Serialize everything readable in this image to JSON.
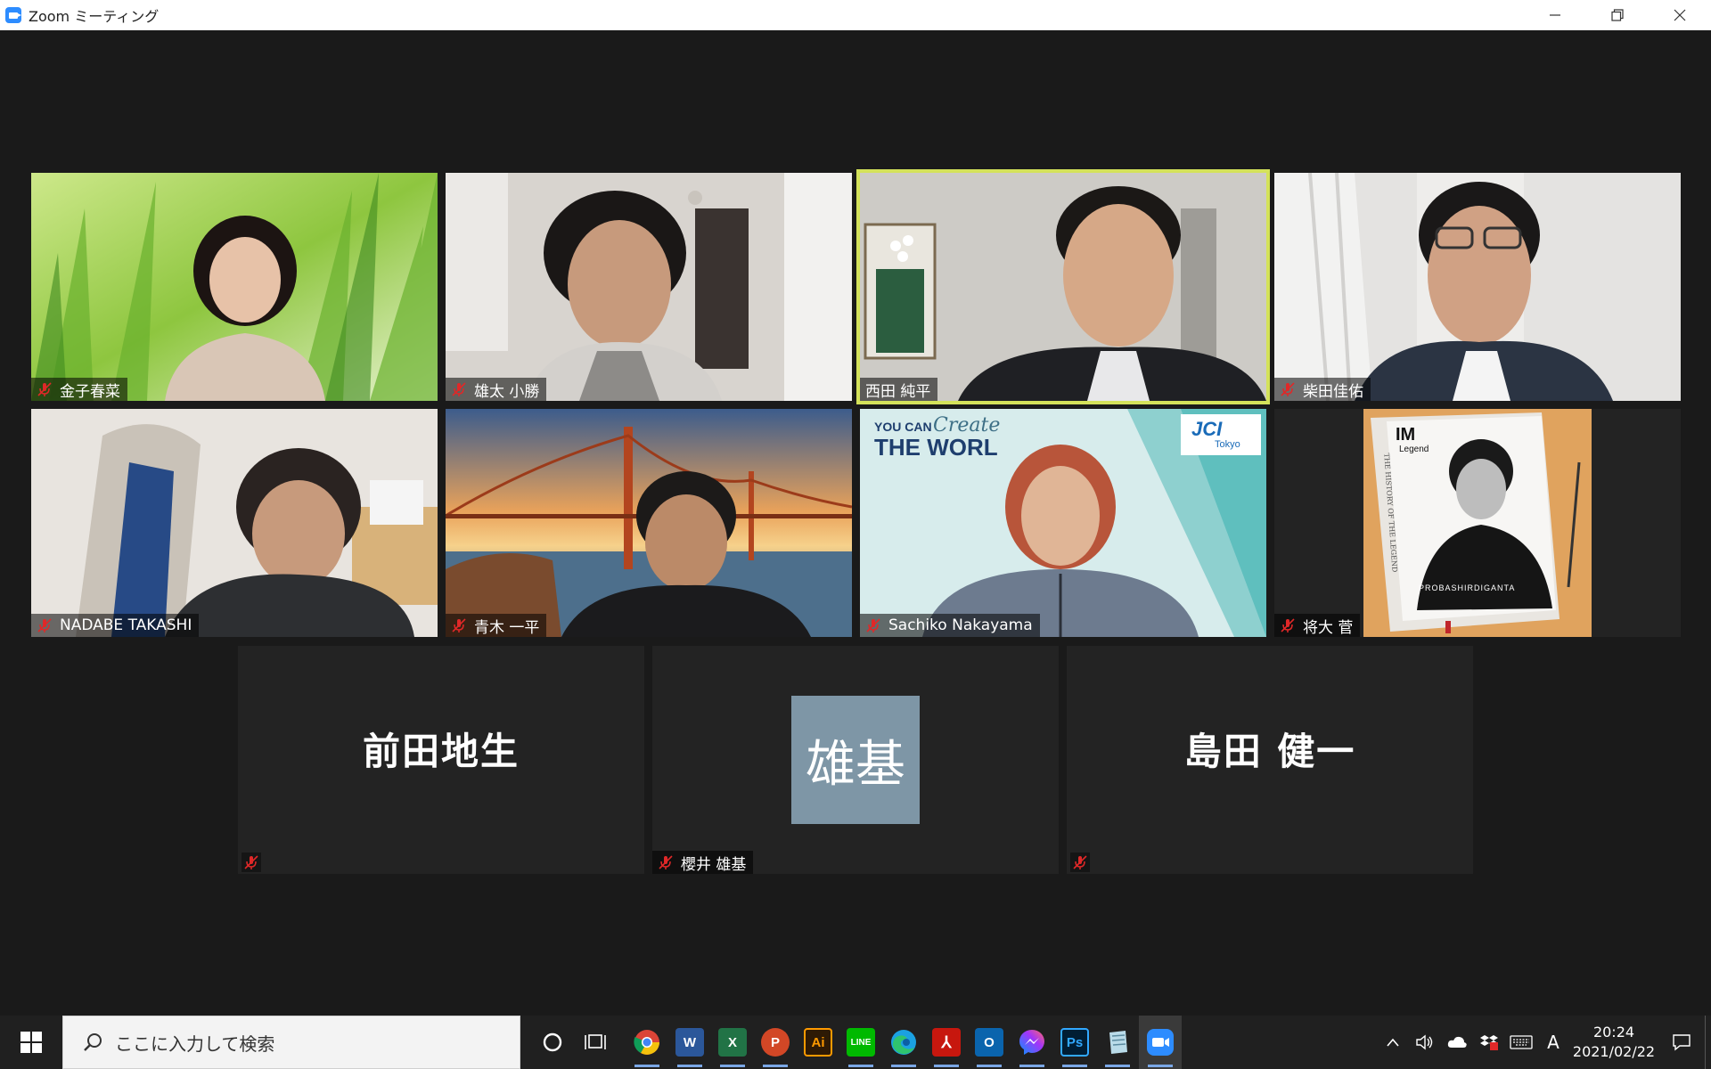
{
  "window": {
    "title": "Zoom ミーティング"
  },
  "participants": [
    {
      "name": "金子春菜",
      "muted": true
    },
    {
      "name": "雄太 小勝",
      "muted": true
    },
    {
      "name": "西田 純平",
      "muted": false,
      "speaking": true
    },
    {
      "name": "柴田佳佑",
      "muted": true
    },
    {
      "name": "NADABE TAKASHI",
      "muted": true
    },
    {
      "name": "青木 一平",
      "muted": true
    },
    {
      "name": "Sachiko Nakayama",
      "muted": true
    },
    {
      "name": "将大 菅",
      "muted": true
    },
    {
      "display": "前田地生",
      "muted": true
    },
    {
      "name": "櫻井 雄基",
      "initials": "雄基",
      "muted": true
    },
    {
      "display": "島田 健一",
      "muted": true
    }
  ],
  "tiles": {
    "jci_slogan_top": "YOU CAN",
    "jci_slogan_script": "Create",
    "jci_slogan_bottom": "THE WORL",
    "jci_logo": "JCI",
    "jci_city": "Tokyo",
    "book_logo": "IM",
    "book_sub": "Legend",
    "book_footer": "PROBASHIRDIGANTA",
    "book_spine": "THE HISTORY OF THE LEGEND"
  },
  "taskbar": {
    "search_placeholder": "ここに入力して検索",
    "apps": [
      "chrome",
      "word",
      "excel",
      "powerpoint",
      "illustrator",
      "line",
      "edge",
      "acrobat",
      "outlook",
      "messenger",
      "photoshop",
      "notepad",
      "zoom"
    ],
    "ime": "A",
    "time": "20:24",
    "date": "2021/02/22"
  },
  "colors": {
    "speaking_border": "#d4e25a",
    "zoom_blue": "#2d8cff",
    "mute_red": "#e02828"
  }
}
